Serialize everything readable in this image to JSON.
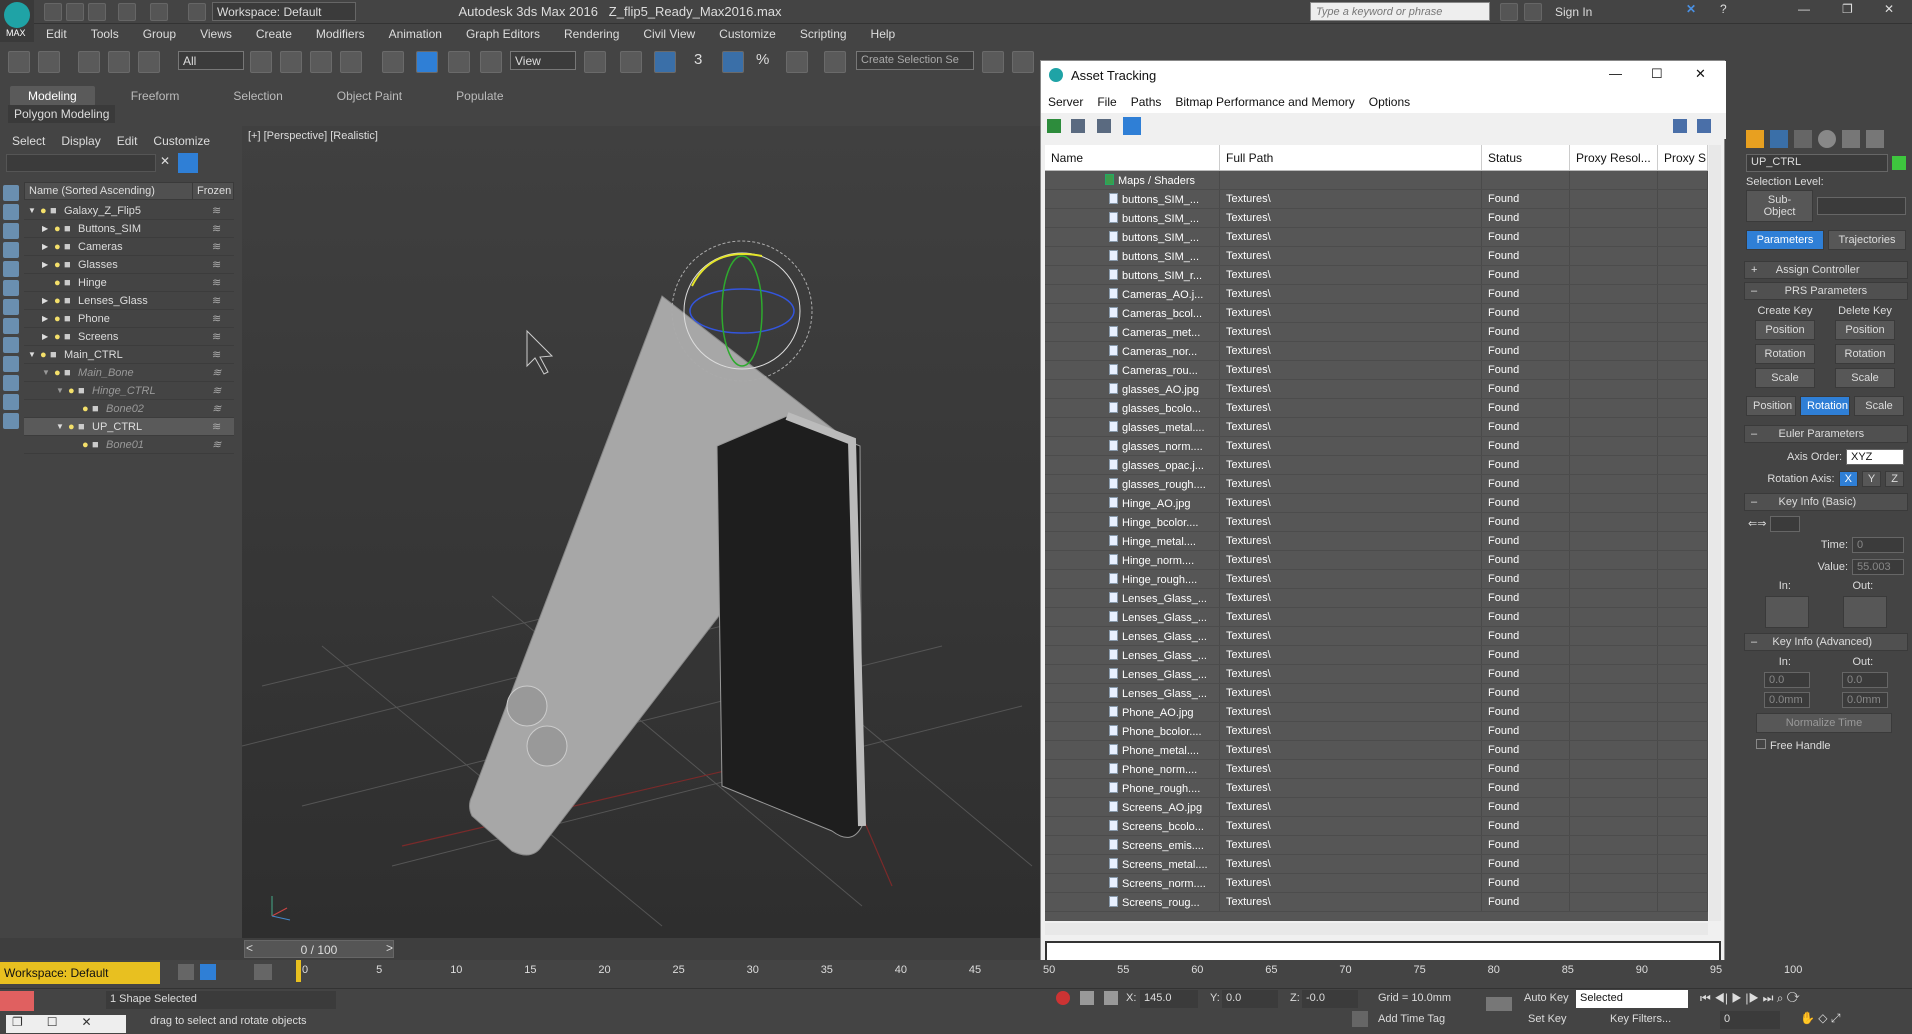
{
  "app": {
    "title": "Autodesk 3ds Max 2016",
    "file": "Z_flip5_Ready_Max2016.max",
    "logo_text": "MAX",
    "workspace": "Workspace: Default",
    "search_placeholder": "Type a keyword or phrase",
    "sign_in": "Sign In"
  },
  "menu": [
    "Edit",
    "Tools",
    "Group",
    "Views",
    "Create",
    "Modifiers",
    "Animation",
    "Graph Editors",
    "Rendering",
    "Civil View",
    "Customize",
    "Scripting",
    "Help"
  ],
  "toolbar": {
    "selection_filter": "All",
    "view_dropdown": "View",
    "numbers": [
      "3",
      "%"
    ],
    "selection_set": "Create Selection Se"
  },
  "ribbon": {
    "tabs": [
      "Modeling",
      "Freeform",
      "Selection",
      "Object Paint",
      "Populate"
    ],
    "active_tab": "Modeling",
    "sub_label": "Polygon Modeling"
  },
  "explorer": {
    "menu": [
      "Select",
      "Display",
      "Edit",
      "Customize"
    ],
    "col_name": "Name (Sorted Ascending)",
    "col_frozen": "Frozen",
    "rows": [
      {
        "label": "Galaxy_Z_Flip5",
        "indent": 0,
        "expand": "▼"
      },
      {
        "label": "Buttons_SIM",
        "indent": 1,
        "expand": "▶"
      },
      {
        "label": "Cameras",
        "indent": 1,
        "expand": "▶"
      },
      {
        "label": "Glasses",
        "indent": 1,
        "expand": "▶"
      },
      {
        "label": "Hinge",
        "indent": 1,
        "expand": ""
      },
      {
        "label": "Lenses_Glass",
        "indent": 1,
        "expand": "▶"
      },
      {
        "label": "Phone",
        "indent": 1,
        "expand": "▶"
      },
      {
        "label": "Screens",
        "indent": 1,
        "expand": "▶"
      },
      {
        "label": "Main_CTRL",
        "indent": 0,
        "expand": "▼"
      },
      {
        "label": "Main_Bone",
        "indent": 1,
        "expand": "▼",
        "dim": true
      },
      {
        "label": "Hinge_CTRL",
        "indent": 2,
        "expand": "▼",
        "dim": true
      },
      {
        "label": "Bone02",
        "indent": 3,
        "expand": "",
        "dim": true
      },
      {
        "label": "UP_CTRL",
        "indent": 2,
        "expand": "▼",
        "sel": true
      },
      {
        "label": "Bone01",
        "indent": 3,
        "expand": "",
        "dim": true
      }
    ]
  },
  "viewport": {
    "label": "[+] [Perspective] [Realistic]"
  },
  "dialog": {
    "title": "Asset Tracking",
    "menu": [
      "Server",
      "File",
      "Paths",
      "Bitmap Performance and Memory",
      "Options"
    ],
    "columns": [
      "Name",
      "Full Path",
      "Status",
      "Proxy Resol...",
      "Proxy S"
    ],
    "group": "Maps / Shaders",
    "rows": [
      {
        "name": "buttons_SIM_...",
        "path": "Textures\\",
        "status": "Found"
      },
      {
        "name": "buttons_SIM_...",
        "path": "Textures\\",
        "status": "Found"
      },
      {
        "name": "buttons_SIM_...",
        "path": "Textures\\",
        "status": "Found"
      },
      {
        "name": "buttons_SIM_...",
        "path": "Textures\\",
        "status": "Found"
      },
      {
        "name": "buttons_SIM_r...",
        "path": "Textures\\",
        "status": "Found"
      },
      {
        "name": "Cameras_AO.j...",
        "path": "Textures\\",
        "status": "Found"
      },
      {
        "name": "Cameras_bcol...",
        "path": "Textures\\",
        "status": "Found"
      },
      {
        "name": "Cameras_met...",
        "path": "Textures\\",
        "status": "Found"
      },
      {
        "name": "Cameras_nor...",
        "path": "Textures\\",
        "status": "Found"
      },
      {
        "name": "Cameras_rou...",
        "path": "Textures\\",
        "status": "Found"
      },
      {
        "name": "glasses_AO.jpg",
        "path": "Textures\\",
        "status": "Found"
      },
      {
        "name": "glasses_bcolo...",
        "path": "Textures\\",
        "status": "Found"
      },
      {
        "name": "glasses_metal....",
        "path": "Textures\\",
        "status": "Found"
      },
      {
        "name": "glasses_norm....",
        "path": "Textures\\",
        "status": "Found"
      },
      {
        "name": "glasses_opac.j...",
        "path": "Textures\\",
        "status": "Found"
      },
      {
        "name": "glasses_rough....",
        "path": "Textures\\",
        "status": "Found"
      },
      {
        "name": "Hinge_AO.jpg",
        "path": "Textures\\",
        "status": "Found"
      },
      {
        "name": "Hinge_bcolor....",
        "path": "Textures\\",
        "status": "Found"
      },
      {
        "name": "Hinge_metal....",
        "path": "Textures\\",
        "status": "Found"
      },
      {
        "name": "Hinge_norm....",
        "path": "Textures\\",
        "status": "Found"
      },
      {
        "name": "Hinge_rough....",
        "path": "Textures\\",
        "status": "Found"
      },
      {
        "name": "Lenses_Glass_...",
        "path": "Textures\\",
        "status": "Found"
      },
      {
        "name": "Lenses_Glass_...",
        "path": "Textures\\",
        "status": "Found"
      },
      {
        "name": "Lenses_Glass_...",
        "path": "Textures\\",
        "status": "Found"
      },
      {
        "name": "Lenses_Glass_...",
        "path": "Textures\\",
        "status": "Found"
      },
      {
        "name": "Lenses_Glass_...",
        "path": "Textures\\",
        "status": "Found"
      },
      {
        "name": "Lenses_Glass_...",
        "path": "Textures\\",
        "status": "Found"
      },
      {
        "name": "Phone_AO.jpg",
        "path": "Textures\\",
        "status": "Found"
      },
      {
        "name": "Phone_bcolor....",
        "path": "Textures\\",
        "status": "Found"
      },
      {
        "name": "Phone_metal....",
        "path": "Textures\\",
        "status": "Found"
      },
      {
        "name": "Phone_norm....",
        "path": "Textures\\",
        "status": "Found"
      },
      {
        "name": "Phone_rough....",
        "path": "Textures\\",
        "status": "Found"
      },
      {
        "name": "Screens_AO.jpg",
        "path": "Textures\\",
        "status": "Found"
      },
      {
        "name": "Screens_bcolo...",
        "path": "Textures\\",
        "status": "Found"
      },
      {
        "name": "Screens_emis....",
        "path": "Textures\\",
        "status": "Found"
      },
      {
        "name": "Screens_metal....",
        "path": "Textures\\",
        "status": "Found"
      },
      {
        "name": "Screens_norm....",
        "path": "Textures\\",
        "status": "Found"
      },
      {
        "name": "Screens_roug...",
        "path": "Textures\\",
        "status": "Found"
      }
    ]
  },
  "command_panel": {
    "object_name": "UP_CTRL",
    "selection_level": "Selection Level:",
    "sub_object": "Sub-Object",
    "tabs": [
      "Parameters",
      "Trajectories"
    ],
    "assign_controller": "Assign Controller",
    "prs": "PRS Parameters",
    "create_key": "Create Key",
    "delete_key": "Delete Key",
    "pos": "Position",
    "rot": "Rotation",
    "scale": "Scale",
    "euler": "Euler Parameters",
    "axis_order_label": "Axis Order:",
    "axis_order": "XYZ",
    "rotation_axis": "Rotation Axis:",
    "axes": [
      "X",
      "Y",
      "Z"
    ],
    "key_basic": "Key Info (Basic)",
    "time_label": "Time:",
    "time_val": "0",
    "value_label": "Value:",
    "value_val": "55.003",
    "in": "In:",
    "out": "Out:",
    "key_adv": "Key Info (Advanced)",
    "in_val": "0.0",
    "out_val": "0.0",
    "mm_in": "0.0mm",
    "mm_out": "0.0mm",
    "normalize": "Normalize Time",
    "free_handle": "Free Handle"
  },
  "timeline": {
    "frame": "0 / 100",
    "ticks": [
      "0",
      "5",
      "10",
      "15",
      "20",
      "25",
      "30",
      "35",
      "40",
      "45",
      "50",
      "55",
      "60",
      "65",
      "70",
      "75",
      "80",
      "85",
      "90",
      "95",
      "100"
    ]
  },
  "status": {
    "workspace": "Workspace: Default",
    "shapes": "1 Shape Selected",
    "hint": "drag to select and rotate objects",
    "x_label": "X:",
    "x": "145.0",
    "y_label": "Y:",
    "y": "0.0",
    "z_label": "Z:",
    "z": "-0.0",
    "grid": "Grid = 10.0mm",
    "auto_key": "Auto Key",
    "selected": "Selected",
    "set_key": "Set Key",
    "key_filters": "Key Filters...",
    "add_time_tag": "Add Time Tag",
    "frame_field": "0"
  },
  "colors": {
    "accent": "#2f7fd6",
    "bg": "#444444",
    "grid": "#565656",
    "logo": "#1fa3a6"
  }
}
